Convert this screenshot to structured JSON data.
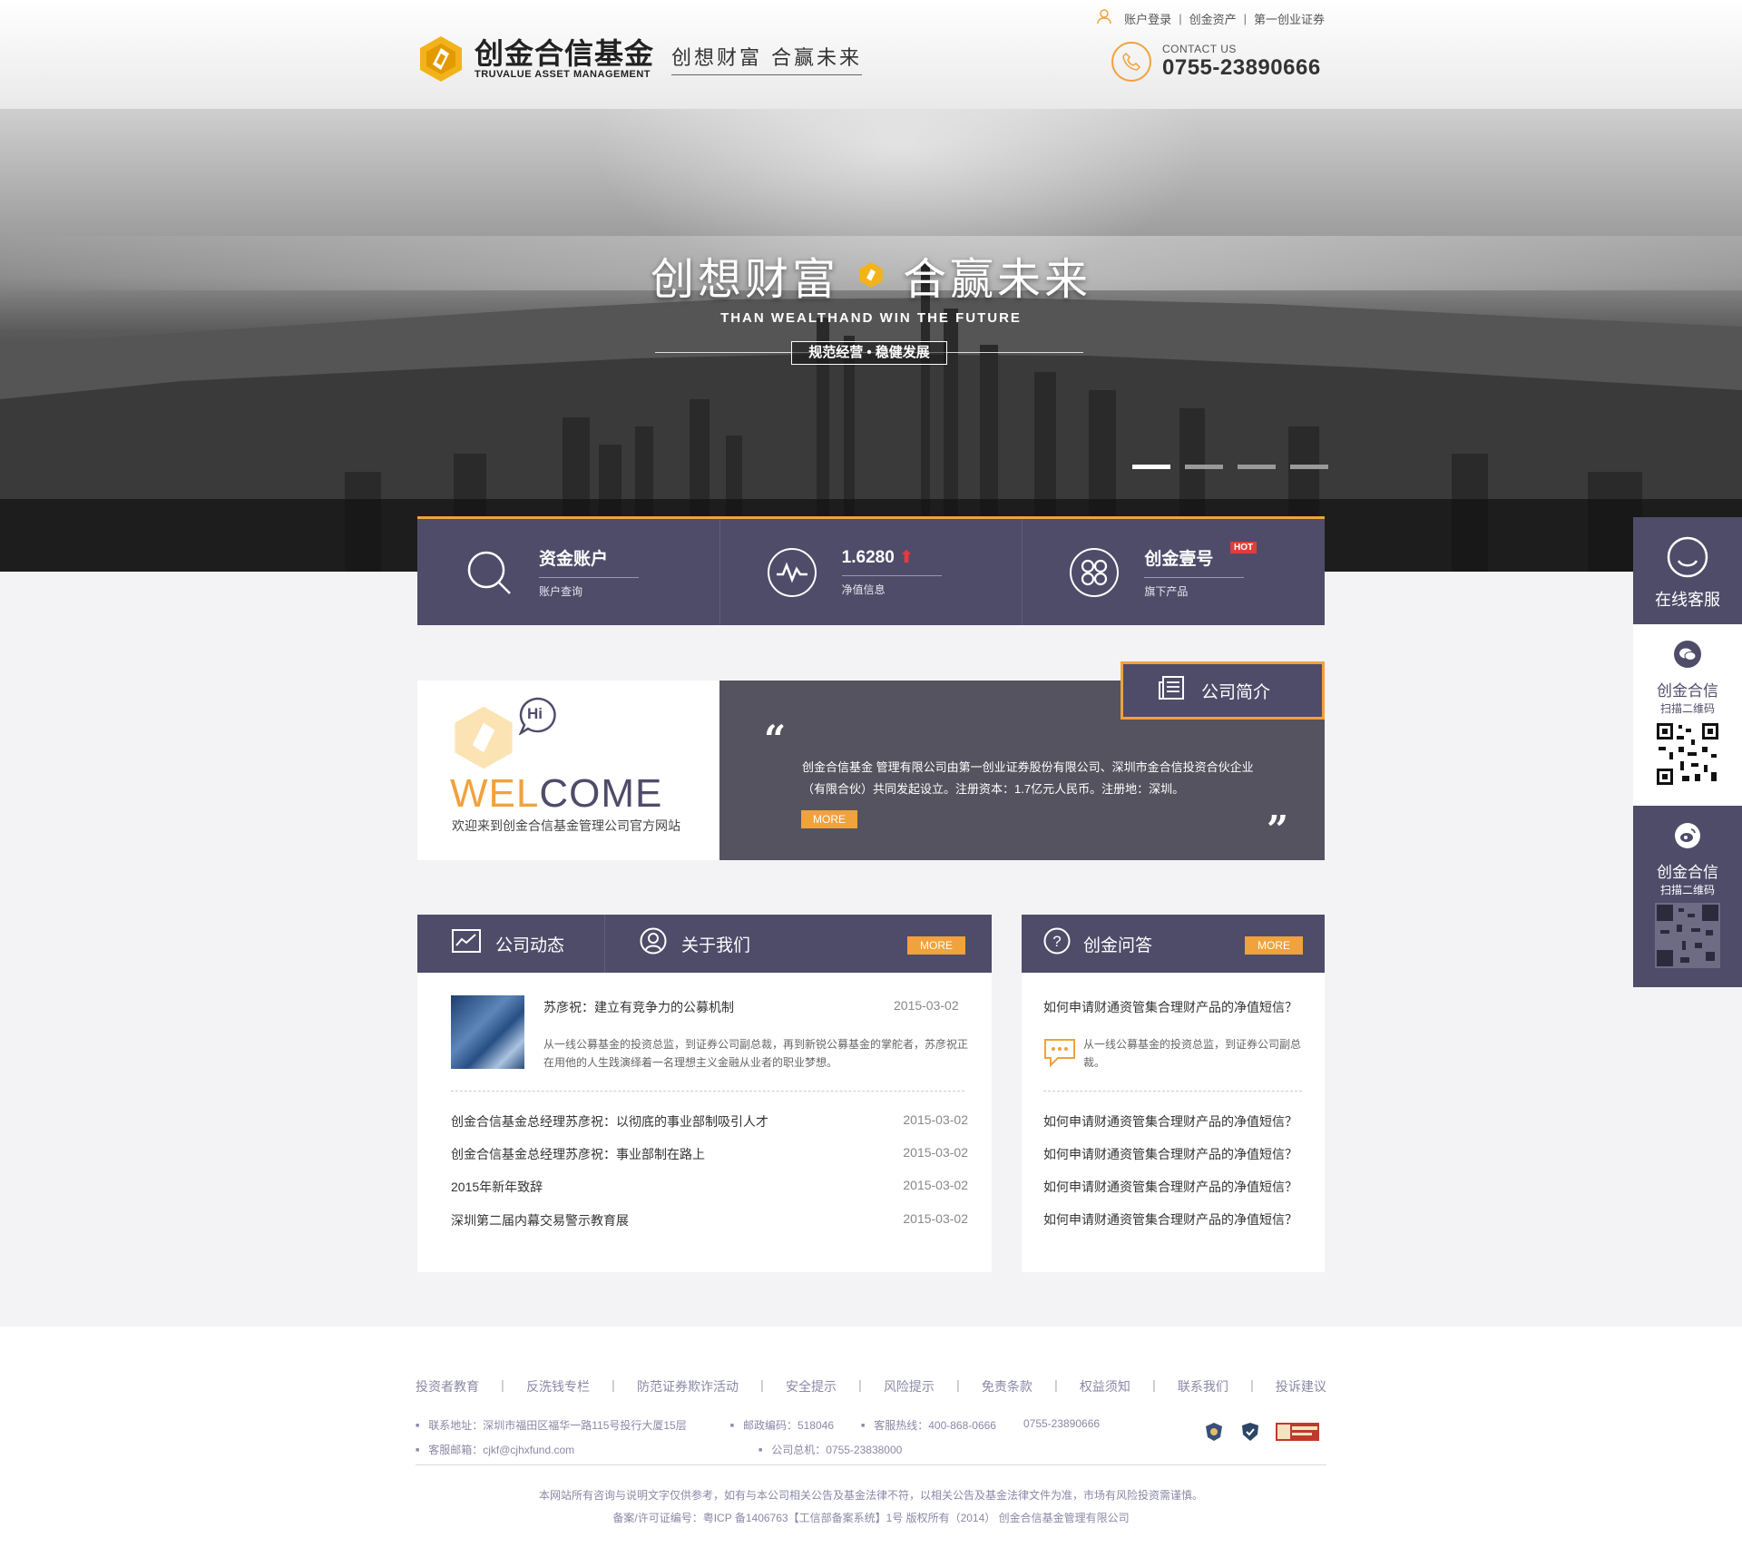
{
  "top_links": {
    "login": "账户登录",
    "assets": "创金资产",
    "securities": "第一创业证券",
    "sep": "|"
  },
  "logo": {
    "cn": "创金合信基金",
    "en": "TRUVALUE ASSET MANAGEMENT"
  },
  "slogan": "创想财富 合赢未来",
  "contact": {
    "label": "CONTACT US",
    "phone": "0755-23890666"
  },
  "banner": {
    "title_left": "创想财富",
    "title_right": "合赢未来",
    "subtitle": "THAN WEALTHAND WIN THE FUTURE",
    "tag": "规范经营 • 稳健发展",
    "slides": 4,
    "active_slide": 1
  },
  "services": [
    {
      "title": "资金账户",
      "sub": "账户查询",
      "icon": "search-icon"
    },
    {
      "title": "1.6280",
      "sub": "净值信息",
      "icon": "chart-icon",
      "trend": "up"
    },
    {
      "title": "创金壹号",
      "sub": "旗下产品",
      "icon": "product-icon",
      "badge": "HOT"
    }
  ],
  "welcome": {
    "word_a": "WEL",
    "word_b": "COME",
    "bubble": "Hi",
    "text": "欢迎来到创金合信基金管理公司官方网站"
  },
  "intro": {
    "tab": "公司简介",
    "text": "创金合信基金 管理有限公司由第一创业证券股份有限公司、深圳市金合信投资合伙企业（有限合伙）共同发起设立。注册资本：1.7亿元人民币。注册地：深圳。",
    "more": "MORE",
    "quote_open": "“",
    "quote_close": "”"
  },
  "news": {
    "tab1": "公司动态",
    "tab2": "关于我们",
    "more": "MORE",
    "featured": {
      "title": "苏彦祝：建立有竞争力的公募机制",
      "date": "2015-03-02",
      "desc": "从一线公募基金的投资总监，到证券公司副总裁，再到新锐公募基金的掌舵者，苏彦祝正在用他的人生践演绎着一名理想主义金融从业者的职业梦想。"
    },
    "items": [
      {
        "title": "创金合信基金总经理苏彦祝：以彻底的事业部制吸引人才",
        "date": "2015-03-02"
      },
      {
        "title": "创金合信基金总经理苏彦祝：事业部制在路上",
        "date": "2015-03-02"
      },
      {
        "title": "2015年新年致辞",
        "date": "2015-03-02"
      },
      {
        "title": "深圳第二届内幕交易警示教育展",
        "date": "2015-03-02"
      }
    ]
  },
  "qa": {
    "title": "创金问答",
    "more": "MORE",
    "featured": {
      "q": "如何申请财通资管集合理财产品的净值短信？",
      "a": "从一线公募基金的投资总监，到证券公司副总裁。"
    },
    "items": [
      "如何申请财通资管集合理财产品的净值短信？",
      "如何申请财通资管集合理财产品的净值短信？",
      "如何申请财通资管集合理财产品的净值短信？",
      "如何申请财通资管集合理财产品的净值短信？"
    ]
  },
  "side": {
    "cs": "在线客服",
    "wechat_name": "创金合信",
    "wechat_scan": "扫描二维码",
    "weibo_name": "创金合信",
    "weibo_scan": "扫描二维码"
  },
  "footer": {
    "links": [
      "投资者教育",
      "反洗钱专栏",
      "防范证券欺诈活动",
      "安全提示",
      "风险提示",
      "免责条款",
      "权益须知",
      "联系我们",
      "投诉建议"
    ],
    "sep": "|",
    "address": "联系地址：深圳市福田区福华一路115号投行大厦15层",
    "postcode": "邮政编码：518046",
    "hotline": "客服热线：400-868-0666",
    "hotline2": "0755-23890666",
    "email": "客服邮箱：cjkf@cjhxfund.com",
    "switchboard": "公司总机：0755-23838000",
    "disclaimer": "本网站所有咨询与说明文字仅供参考，如有与本公司相关公告及基金法律不符，以相关公告及基金法律文件为准，市场有风险投资需谨慎。",
    "icp": "备案/许可证编号：粤ICP 备1406763【工信部备案系统】1号 版权所有（2014） 创金合信基金管理有限公司"
  },
  "colors": {
    "accent": "#f0a23c",
    "brand": "#4f4c6a",
    "intro_bg": "#55535f",
    "hot": "#e23c3c"
  }
}
